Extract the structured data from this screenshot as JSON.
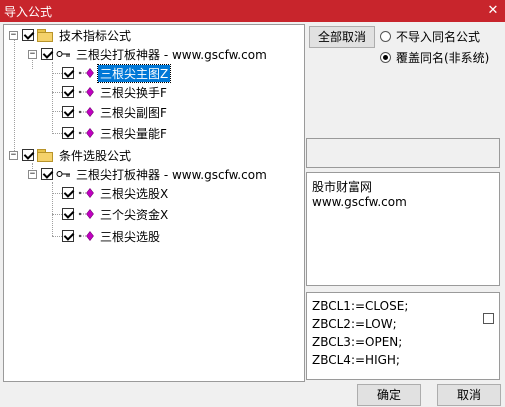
{
  "window": {
    "title": "导入公式",
    "close_glyph": "✕"
  },
  "tree": [
    {
      "id": "n0",
      "label": "技术指标公式",
      "type": "folder",
      "expander": "−",
      "checked": true
    },
    {
      "id": "n1",
      "label": "三根尖打板神器 - www.gscfw.com",
      "type": "key",
      "expander": "−",
      "checked": true
    },
    {
      "id": "n2",
      "label": "三根尖主图Z",
      "type": "formula",
      "checked": true,
      "selected": true
    },
    {
      "id": "n3",
      "label": "三根尖换手F",
      "type": "formula",
      "checked": true
    },
    {
      "id": "n4",
      "label": "三根尖副图F",
      "type": "formula",
      "checked": true
    },
    {
      "id": "n5",
      "label": "三根尖量能F",
      "type": "formula",
      "checked": true
    },
    {
      "id": "n6",
      "label": "条件选股公式",
      "type": "folder",
      "expander": "−",
      "checked": true
    },
    {
      "id": "n7",
      "label": "三根尖打板神器 - www.gscfw.com",
      "type": "key",
      "expander": "−",
      "checked": true
    },
    {
      "id": "n8",
      "label": "三根尖选股X",
      "type": "formula",
      "checked": true
    },
    {
      "id": "n9",
      "label": "三个尖资金X",
      "type": "formula",
      "checked": true
    },
    {
      "id": "n10",
      "label": "三根尖选股",
      "type": "formula",
      "checked": true
    }
  ],
  "controls": {
    "deselect_all": "全部取消",
    "radio_skip": "不导入同名公式",
    "radio_overwrite": "覆盖同名(非系统)"
  },
  "description": {
    "line1": "股市财富网",
    "line2": "www.gscfw.com"
  },
  "code": {
    "l1": "ZBCL1:=CLOSE;",
    "l2": "ZBCL2:=LOW;",
    "l3": "ZBCL3:=OPEN;",
    "l4": "ZBCL4:=HIGH;"
  },
  "buttons": {
    "ok": "确定",
    "cancel": "取消"
  },
  "colors": {
    "titlebar": "#c8252c",
    "selection": "#0078d7",
    "formula_icon": "#c000c0"
  }
}
